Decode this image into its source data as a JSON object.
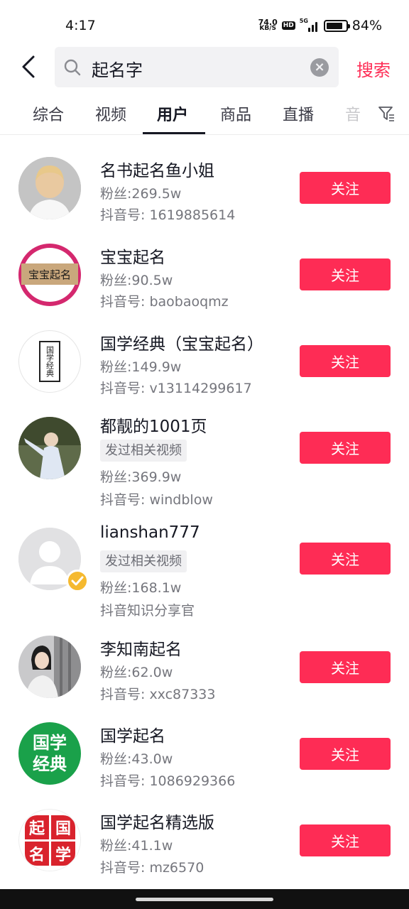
{
  "status_bar": {
    "time": "4:17",
    "net_speed_value": "74.0",
    "net_speed_unit": "KB/S",
    "hd_badge": "HD",
    "network_type": "5G",
    "battery_percent": "84%",
    "battery_level": 0.84
  },
  "search": {
    "query": "起名字",
    "search_button": "搜索"
  },
  "tabs": [
    {
      "label": "综合",
      "active": false
    },
    {
      "label": "视频",
      "active": false
    },
    {
      "label": "用户",
      "active": true
    },
    {
      "label": "商品",
      "active": false
    },
    {
      "label": "直播",
      "active": false
    },
    {
      "label": "音",
      "active": false
    }
  ],
  "users": [
    {
      "name": "名书起名鱼小姐",
      "fans": "粉丝:269.5w",
      "id_line": "抖音号: 1619885614",
      "tag": "",
      "follow": "关注"
    },
    {
      "name": "宝宝起名",
      "fans": "粉丝:90.5w",
      "id_line": "抖音号: baobaoqmz",
      "tag": "",
      "follow": "关注",
      "avatar_text": "宝宝起名"
    },
    {
      "name": "国学经典（宝宝起名）",
      "fans": "粉丝:149.9w",
      "id_line": "抖音号: v13114299617",
      "tag": "",
      "follow": "关注",
      "avatar_text": "国学经典"
    },
    {
      "name": "都靓的1001页",
      "fans": "粉丝:369.9w",
      "id_line": "抖音号: windblow",
      "tag": "发过相关视频",
      "follow": "关注"
    },
    {
      "name": "lianshan777",
      "fans": "粉丝:168.1w",
      "id_line": "抖音知识分享官",
      "tag": "发过相关视频",
      "follow": "关注"
    },
    {
      "name": "李知南起名",
      "fans": "粉丝:62.0w",
      "id_line": "抖音号: xxc87333",
      "tag": "",
      "follow": "关注"
    },
    {
      "name": "国学起名",
      "fans": "粉丝:43.0w",
      "id_line": "抖音号: 1086929366",
      "tag": "",
      "follow": "关注",
      "avatar_text_1": "国学",
      "avatar_text_2": "经典"
    },
    {
      "name": "国学起名精选版",
      "fans": "粉丝:41.1w",
      "id_line": "抖音号: mz6570",
      "tag": "",
      "follow": "关注",
      "avatar_chars": [
        "起",
        "国",
        "名",
        "学"
      ]
    }
  ],
  "colors": {
    "accent": "#fe2c55",
    "verified": "#f5b92f"
  }
}
